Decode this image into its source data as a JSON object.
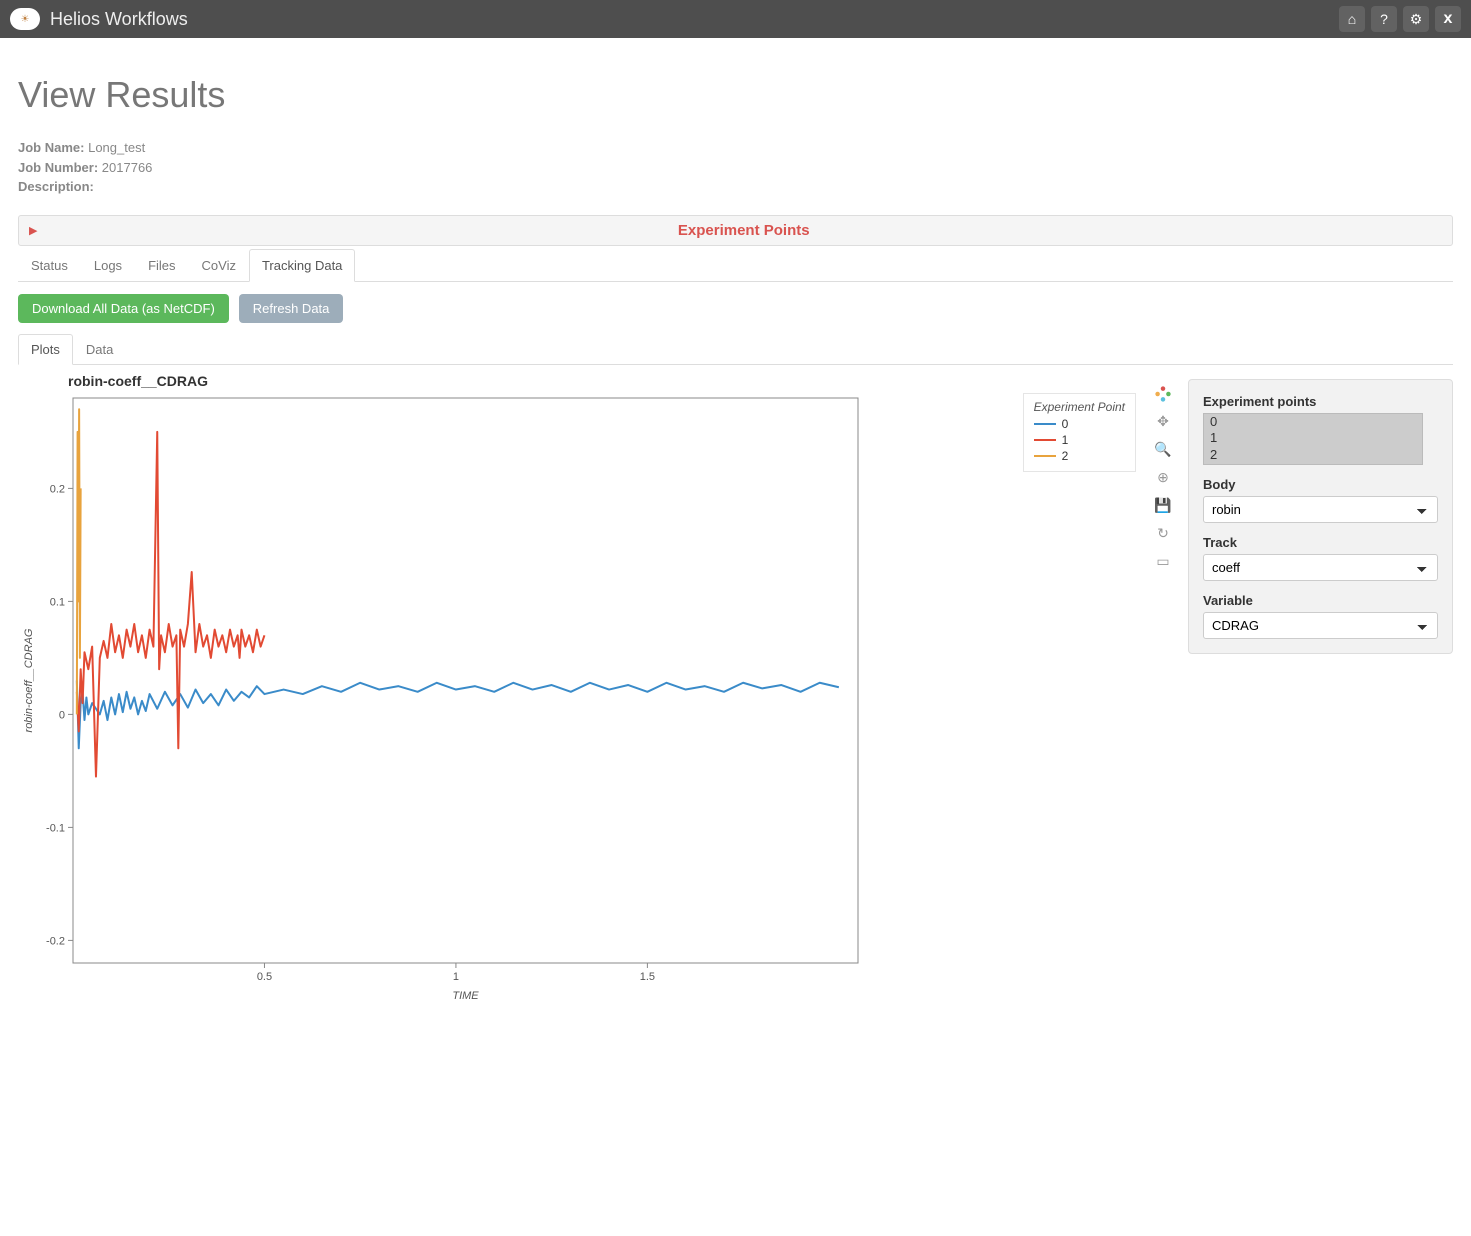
{
  "app": {
    "title": "Helios Workflows"
  },
  "page": {
    "heading": "View Results",
    "job_name_label": "Job Name:",
    "job_name": "Long_test",
    "job_number_label": "Job Number:",
    "job_number": "2017766",
    "description_label": "Description:"
  },
  "exp_panel": {
    "title": "Experiment Points"
  },
  "tabs": [
    "Status",
    "Logs",
    "Files",
    "CoViz",
    "Tracking Data"
  ],
  "active_tab": "Tracking Data",
  "buttons": {
    "download": "Download All Data (as NetCDF)",
    "refresh": "Refresh Data"
  },
  "sub_tabs": [
    "Plots",
    "Data"
  ],
  "active_sub_tab": "Plots",
  "controls": {
    "exp_points_label": "Experiment points",
    "exp_points": [
      "0",
      "1",
      "2"
    ],
    "body_label": "Body",
    "body_value": "robin",
    "track_label": "Track",
    "track_value": "coeff",
    "variable_label": "Variable",
    "variable_value": "CDRAG"
  },
  "chart_data": {
    "type": "line",
    "title": "robin-coeff__CDRAG",
    "xlabel": "TIME",
    "ylabel": "robin-coeff__CDRAG",
    "xlim": [
      0,
      2.05
    ],
    "ylim": [
      -0.22,
      0.28
    ],
    "xticks": [
      0.5,
      1,
      1.5
    ],
    "yticks": [
      -0.2,
      -0.1,
      0,
      0.1,
      0.2
    ],
    "legend_title": "Experiment Point",
    "colors": {
      "0": "#3a8bc9",
      "1": "#e24a33",
      "2": "#e8a33d"
    },
    "series": [
      {
        "name": "0",
        "x": [
          0.01,
          0.015,
          0.02,
          0.025,
          0.03,
          0.035,
          0.04,
          0.05,
          0.06,
          0.07,
          0.08,
          0.09,
          0.1,
          0.11,
          0.12,
          0.13,
          0.14,
          0.15,
          0.16,
          0.17,
          0.18,
          0.19,
          0.2,
          0.22,
          0.24,
          0.26,
          0.28,
          0.3,
          0.32,
          0.34,
          0.36,
          0.38,
          0.4,
          0.42,
          0.44,
          0.46,
          0.48,
          0.5,
          0.55,
          0.6,
          0.65,
          0.7,
          0.75,
          0.8,
          0.85,
          0.9,
          0.95,
          1.0,
          1.05,
          1.1,
          1.15,
          1.2,
          1.25,
          1.3,
          1.35,
          1.4,
          1.45,
          1.5,
          1.55,
          1.6,
          1.65,
          1.7,
          1.75,
          1.8,
          1.85,
          1.9,
          1.95,
          2.0
        ],
        "y": [
          0.03,
          -0.03,
          0.01,
          0.02,
          -0.005,
          0.015,
          0.0,
          0.01,
          0.005,
          0.0,
          0.012,
          -0.005,
          0.015,
          0.0,
          0.018,
          0.002,
          0.02,
          0.005,
          0.015,
          0.0,
          0.012,
          0.003,
          0.018,
          0.005,
          0.02,
          0.008,
          0.018,
          0.006,
          0.022,
          0.01,
          0.018,
          0.008,
          0.022,
          0.012,
          0.02,
          0.015,
          0.025,
          0.018,
          0.022,
          0.018,
          0.025,
          0.02,
          0.028,
          0.022,
          0.025,
          0.02,
          0.028,
          0.022,
          0.025,
          0.02,
          0.028,
          0.022,
          0.026,
          0.02,
          0.028,
          0.022,
          0.026,
          0.02,
          0.028,
          0.022,
          0.025,
          0.02,
          0.028,
          0.023,
          0.026,
          0.02,
          0.028,
          0.024
        ]
      },
      {
        "name": "1",
        "x": [
          0.01,
          0.015,
          0.02,
          0.025,
          0.03,
          0.04,
          0.05,
          0.06,
          0.07,
          0.08,
          0.09,
          0.1,
          0.11,
          0.12,
          0.13,
          0.14,
          0.15,
          0.16,
          0.17,
          0.18,
          0.19,
          0.2,
          0.21,
          0.22,
          0.225,
          0.23,
          0.24,
          0.25,
          0.26,
          0.27,
          0.275,
          0.28,
          0.29,
          0.3,
          0.31,
          0.32,
          0.33,
          0.34,
          0.35,
          0.36,
          0.37,
          0.38,
          0.39,
          0.4,
          0.41,
          0.42,
          0.43,
          0.435,
          0.44,
          0.45,
          0.46,
          0.47,
          0.48,
          0.49,
          0.5
        ],
        "y": [
          0.02,
          -0.015,
          0.04,
          0.01,
          0.055,
          0.04,
          0.06,
          -0.055,
          0.05,
          0.065,
          0.05,
          0.08,
          0.055,
          0.07,
          0.05,
          0.075,
          0.06,
          0.08,
          0.055,
          0.07,
          0.05,
          0.075,
          0.06,
          0.25,
          0.04,
          0.07,
          0.055,
          0.08,
          0.06,
          0.07,
          -0.03,
          0.075,
          0.06,
          0.08,
          0.126,
          0.055,
          0.08,
          0.06,
          0.07,
          0.05,
          0.075,
          0.06,
          0.07,
          0.055,
          0.075,
          0.06,
          0.07,
          0.05,
          0.075,
          0.06,
          0.07,
          0.055,
          0.075,
          0.06,
          0.07
        ]
      },
      {
        "name": "2",
        "x": [
          0.01,
          0.012,
          0.014,
          0.016,
          0.018,
          0.02
        ],
        "y": [
          0.0,
          0.25,
          0.1,
          0.27,
          0.05,
          0.2
        ]
      }
    ]
  }
}
